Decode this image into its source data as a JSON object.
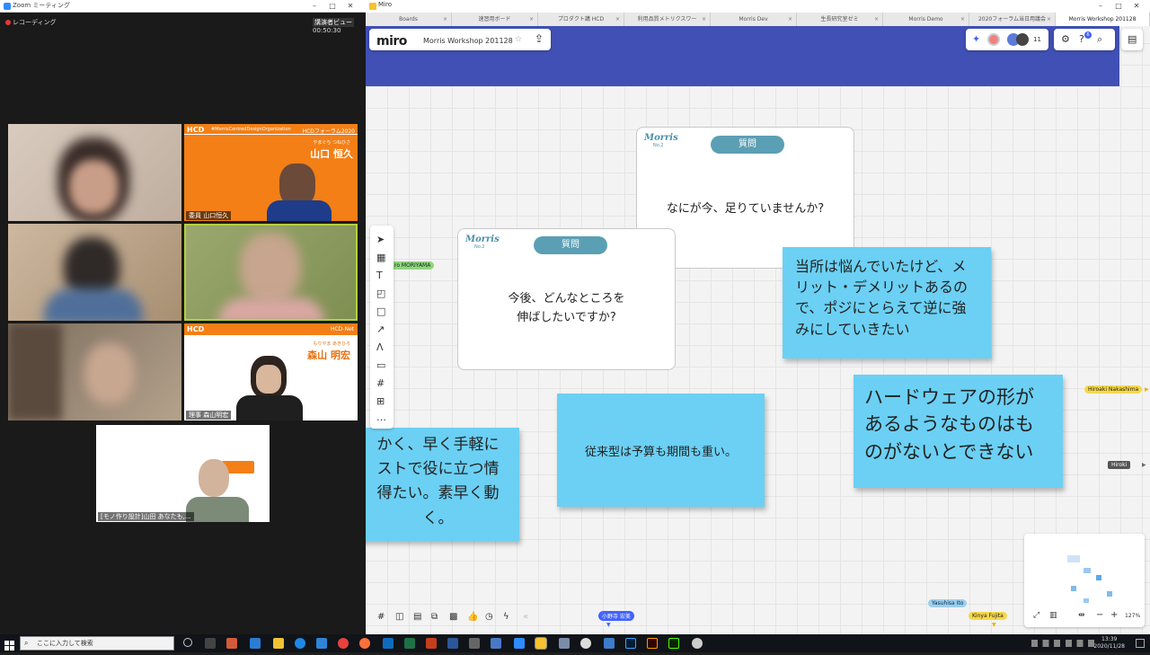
{
  "zoom": {
    "window_title": "Zoom ミーティング",
    "recording_label": "レコーディング",
    "speaker_view_label": "講演者ビュー",
    "timer": "00:50:30",
    "participants": [
      {
        "name": ""
      },
      {
        "name": "委員 山口恒久",
        "slide_name": "山口 恒久",
        "slide_furigana": "やまぐち つねひさ",
        "slide_title": "HCDフォーラム2020",
        "slide_sub": "#MorrisCentredDesignOrganization"
      },
      {
        "name": ""
      },
      {
        "name": ""
      },
      {
        "name": ""
      },
      {
        "name": "理事 森山明宏",
        "slide_name": "森山 明宏",
        "slide_furigana": "もりやま あきひろ",
        "slide_title": "HCD-Net"
      },
      {
        "name": "[モノ作り設計]山田 あなたも,..."
      }
    ]
  },
  "miro": {
    "window_title": "Miro",
    "tabs": [
      "Boards",
      "速習用ボード",
      "プロダクト講 HCD",
      "利用品質メトリクスワー",
      "Morris Dev",
      "生長研究室ゼミ",
      "Morris Demo",
      "2020フォーラム当日用議会",
      "Morris Workshop 201128"
    ],
    "logo": "miro",
    "board_name": "Morris Workshop 201128",
    "star": "☆",
    "collaborator_count": "11",
    "help_badge": "6",
    "cards": [
      {
        "logo": "Morris",
        "number": "No.2",
        "label": "質問",
        "question": "なにが今、足りていませんか?"
      },
      {
        "logo": "Morris",
        "number": "No.2",
        "label": "質問",
        "question_line1": "今後、どんなところを",
        "question_line2": "伸ばしたいですか?"
      }
    ],
    "stickies": [
      {
        "text": "当所は悩んでいたけど、メリット・デメリットあるので、ポジにとらえて逆に強みにしていきたい"
      },
      {
        "text": "従来型は予算も期間も重い。"
      },
      {
        "text": "ハードウェアの形があるようなものはものがないとできない"
      },
      {
        "text": "かく、早く手軽にストで役に立つ情得たい。素早く動く。"
      }
    ],
    "cursors": {
      "left_tag": "ro MORIYAMA",
      "right_tag_1": "Hiroaki Nakashima",
      "right_tag_2": "Hiroki",
      "bottom_tag_1": "小野寺 宏美",
      "bottom_tag_2": "Yasuhisa Ito",
      "bottom_tag_3": "Kinya Fujita"
    },
    "zoom_level": "127%"
  },
  "taskbar": {
    "search_placeholder": "ここに入力して検索",
    "time": "13:39",
    "date": "2020/11/28"
  }
}
